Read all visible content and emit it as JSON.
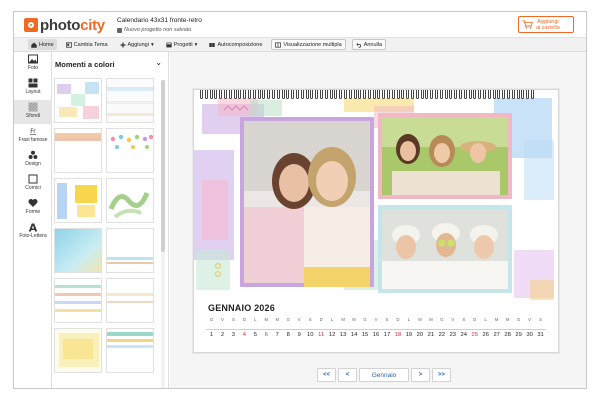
{
  "header": {
    "logo_left": "photo",
    "logo_right": "city",
    "title": "Calendario 43x31 fronte-retro",
    "status": "Nuovo progetto non salvato",
    "cart_line1": "Aggiungi",
    "cart_line2": "al carrello",
    "accent": "#ef6a24"
  },
  "toolbar": {
    "items": [
      {
        "label": "Home",
        "icon": "home-icon"
      },
      {
        "label": "Cambia Tema",
        "icon": "theme-icon"
      },
      {
        "label": "Aggiungi",
        "icon": "plus-icon"
      },
      {
        "label": "Progetti",
        "icon": "folder-icon"
      },
      {
        "label": "Autocomposizione",
        "icon": "autocompose-icon"
      },
      {
        "label": "Visualizzazione multipla",
        "icon": "multiview-icon"
      },
      {
        "label": "Annulla",
        "icon": "undo-icon"
      }
    ]
  },
  "tools": [
    {
      "label": "Foto",
      "icon": "photo-icon"
    },
    {
      "label": "Layout",
      "icon": "layout-icon"
    },
    {
      "label": "Sfondi",
      "icon": "background-icon"
    },
    {
      "label": "Frasi famose",
      "icon": "quote-icon"
    },
    {
      "label": "Design",
      "icon": "design-icon"
    },
    {
      "label": "Cornici",
      "icon": "frame-icon"
    },
    {
      "label": "Forme",
      "icon": "shapes-icon"
    },
    {
      "label": "Foto-Lettera",
      "icon": "letter-icon"
    }
  ],
  "panel": {
    "title": "Momenti a colori"
  },
  "calendar": {
    "month_title": "GENNAIO 2026",
    "weekdays": [
      "G",
      "V",
      "S",
      "D",
      "L",
      "M",
      "M",
      "G",
      "V",
      "S",
      "D",
      "L",
      "M",
      "M",
      "G",
      "V",
      "S",
      "D",
      "L",
      "M",
      "M",
      "G",
      "V",
      "S",
      "D",
      "L",
      "M",
      "M",
      "G",
      "V",
      "S"
    ],
    "days": [
      "1",
      "2",
      "3",
      "4",
      "5",
      "6",
      "7",
      "8",
      "9",
      "10",
      "11",
      "12",
      "13",
      "14",
      "15",
      "16",
      "17",
      "18",
      "19",
      "20",
      "21",
      "22",
      "23",
      "24",
      "25",
      "26",
      "27",
      "28",
      "29",
      "30",
      "31"
    ],
    "sundays": [
      4,
      11,
      18,
      25
    ],
    "holidays": [
      6
    ],
    "sunday_color": "#d0303f"
  },
  "pager": {
    "first": "<<",
    "prev": "<",
    "current": "Gennaio",
    "next": ">",
    "last": ">>"
  }
}
